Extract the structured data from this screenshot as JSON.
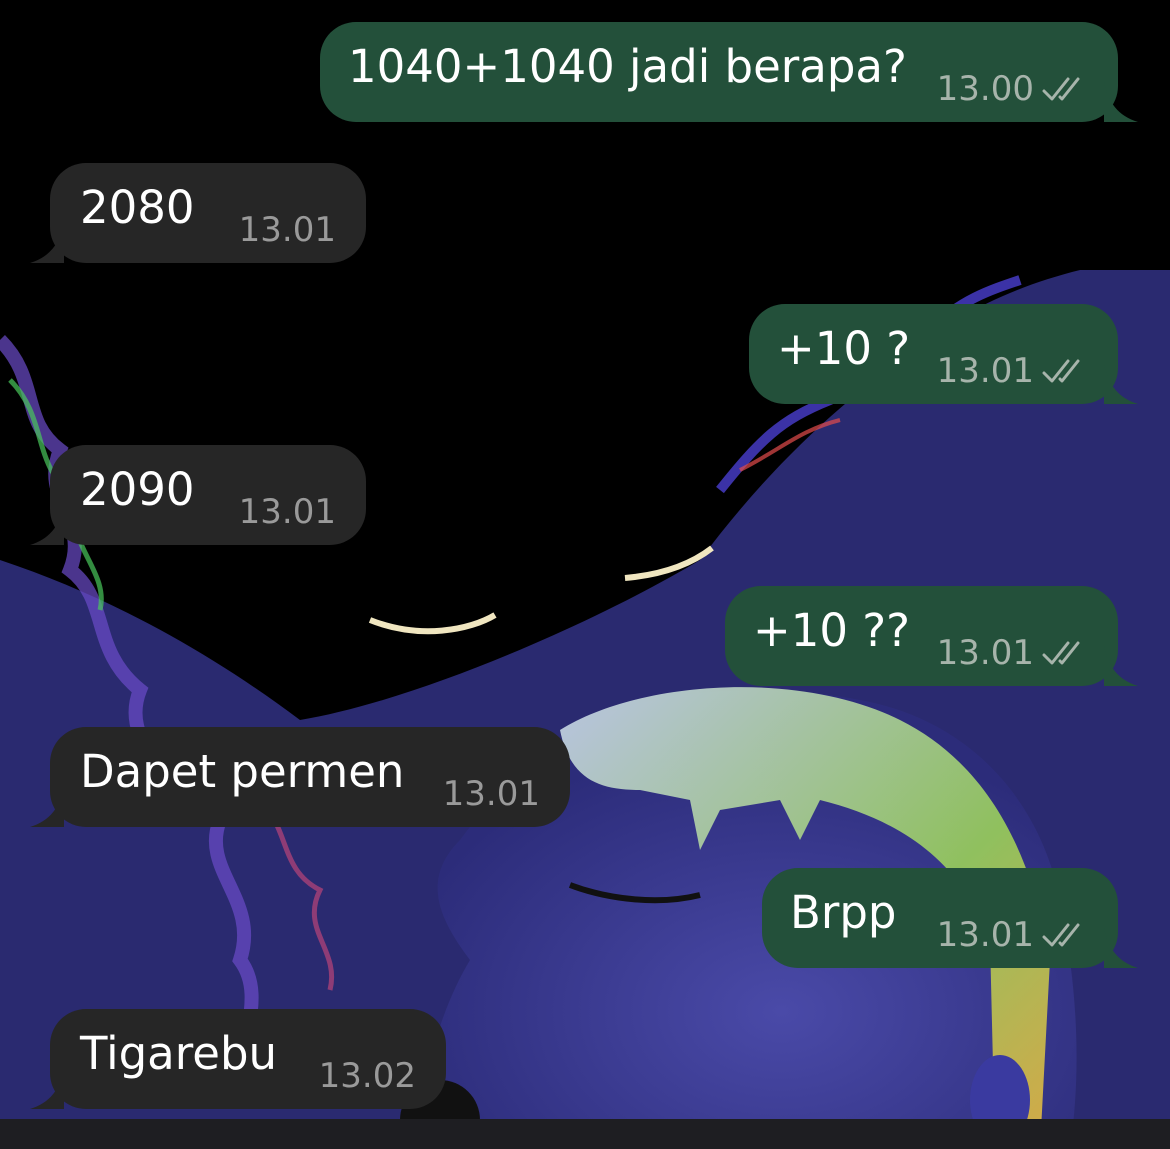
{
  "colors": {
    "outgoing_bubble": "#23503a",
    "incoming_bubble": "#262626",
    "background": "#000000"
  },
  "messages": [
    {
      "direction": "outgoing",
      "text": "1040+1040 jadi berapa?",
      "time": "13.00",
      "status_icon": "double-check-icon"
    },
    {
      "direction": "incoming",
      "text": "2080",
      "time": "13.01"
    },
    {
      "direction": "outgoing",
      "text": "+10 ?",
      "time": "13.01",
      "status_icon": "double-check-icon"
    },
    {
      "direction": "incoming",
      "text": "2090",
      "time": "13.01"
    },
    {
      "direction": "outgoing",
      "text": "+10 ??",
      "time": "13.01",
      "status_icon": "double-check-icon"
    },
    {
      "direction": "incoming",
      "text": "Dapet permen",
      "time": "13.01"
    },
    {
      "direction": "outgoing",
      "text": "Brpp",
      "time": "13.01",
      "status_icon": "double-check-icon"
    },
    {
      "direction": "incoming",
      "text": "Tigarebu",
      "time": "13.02"
    }
  ]
}
